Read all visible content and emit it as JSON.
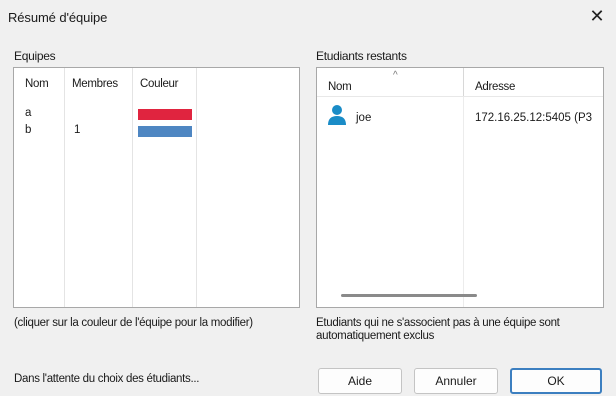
{
  "window": {
    "title": "Résumé d'équipe",
    "close_glyph": "✕"
  },
  "teams": {
    "group_label": "Equipes",
    "columns": [
      "Nom",
      "Membres",
      "Couleur"
    ],
    "rows": [
      {
        "name": "a",
        "members": "",
        "color": "#e0243f"
      },
      {
        "name": "b",
        "members": "1",
        "color": "#4e86c2"
      }
    ],
    "hint": "(cliquer sur la couleur de l'équipe pour la modifier)"
  },
  "students": {
    "group_label": "Etudiants restants",
    "columns": [
      "Nom",
      "Adresse"
    ],
    "sort_glyph": "^",
    "rows": [
      {
        "icon": "user-icon",
        "name": "joe",
        "address": "172.16.25.12:5405 (P3"
      }
    ],
    "note": "Etudiants qui ne s'associent pas à une équipe sont automatiquement exclus"
  },
  "status_text": "Dans l'attente du choix des étudiants...",
  "buttons": {
    "help": "Aide",
    "cancel": "Annuler",
    "ok": "OK"
  },
  "colors": {
    "background": "#f0f0f0",
    "default_button_border": "#3c7fc0",
    "user_icon": "#1a8cc7"
  }
}
